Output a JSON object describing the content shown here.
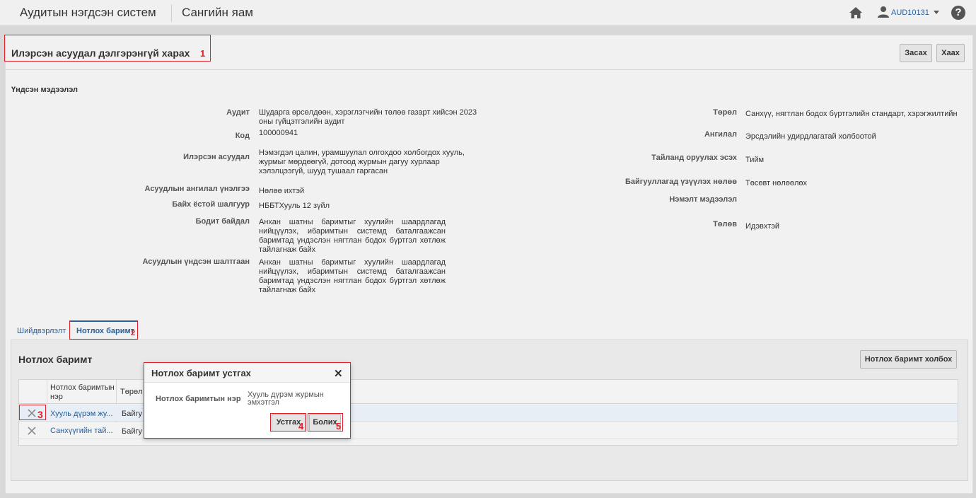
{
  "header": {
    "app_title": "Аудитын нэгдсэн систем",
    "org_title": "Сангийн яам",
    "user_name": "AUD10131"
  },
  "page": {
    "title": "Илэрсэн асуудал дэлгэрэнгүй харах",
    "edit_button": "Засах",
    "close_button": "Хаах",
    "section_title": "Үндсэн мэдээлэл"
  },
  "details_left": [
    {
      "label": "Аудит",
      "value": "Шударга өрсөлдөөн, хэрэглэгчийн төлөө газарт хийсэн 2023 оны гүйцэтгэлийн аудит"
    },
    {
      "label": "Код",
      "value": "100000941"
    },
    {
      "label": "Илэрсэн асуудал",
      "value": "Нэмэгдэл цалин, урамшуулал олгохдоо холбогдох хууль, журмыг мөрдөөгүй, дотоод журмын дагуу хурлаар хэлэлцээгүй, шууд тушаал гаргасан"
    },
    {
      "label": "Асуудлын ангилал үнэлгээ",
      "value": "Нөлөө ихтэй"
    },
    {
      "label": "Байх ёстой шалгуур",
      "value": "НББТХууль 12 зүйл"
    },
    {
      "label": "Бодит байдал",
      "value": "Анхан шатны баримтыг хуулийн шаардлагад нийцүүлэх, ибаримтын системд баталгаажсан баримтад үндэслэн нягтлан бодох бүртгэл хөтлөж тайлагнаж байх"
    },
    {
      "label": "Асуудлын үндсэн шалтгаан",
      "value": "Анхан шатны баримтыг хуулийн шаардлагад нийцүүлэх, ибаримтын системд баталгаажсан баримтад үндэслэн нягтлан бодох бүртгэл хөтлөж тайлагнаж байх"
    }
  ],
  "details_right": [
    {
      "label": "Төрөл",
      "value": "Санхүү, нягтлан бодох бүртгэлийн стандарт, хэрэгжилтийн"
    },
    {
      "label": "Ангилал",
      "value": "Эрсдэлийн удирдлагатай холбоотой"
    },
    {
      "label": "Тайланд оруулах эсэх",
      "value": "Тийм"
    },
    {
      "label": "Байгууллагад үзүүлэх нөлөө",
      "value": "Төсөвт нөлөөлөх"
    },
    {
      "label": "Нэмэлт мэдээлэл",
      "value": ""
    },
    {
      "label": "Төлөв",
      "value": "Идэвхтэй"
    }
  ],
  "tabs": [
    {
      "label": "Шийдвэрлэлт"
    },
    {
      "label": "Нотлох баримт"
    }
  ],
  "evidence": {
    "title": "Нотлох баримт",
    "link_button": "Нотлох баримт холбох",
    "columns": [
      "Нотлох баримтын нэр",
      "Төрөл"
    ],
    "rows": [
      {
        "name": "Хууль дүрэм жу...",
        "type": "Байгу"
      },
      {
        "name": "Санхүүгийн тай...",
        "type": "Байгу"
      }
    ]
  },
  "dialog": {
    "title": "Нотлох баримт устгах",
    "field_label": "Нотлох баримтын нэр",
    "field_value": "Хууль дүрэм журмын эмхэтгэл",
    "delete_button": "Устгах",
    "cancel_button": "Болих"
  },
  "annotations": [
    "1",
    "2",
    "3",
    "4",
    "5"
  ],
  "colors": {
    "accent": "#2a5f97",
    "highlight": "#e0202a"
  }
}
